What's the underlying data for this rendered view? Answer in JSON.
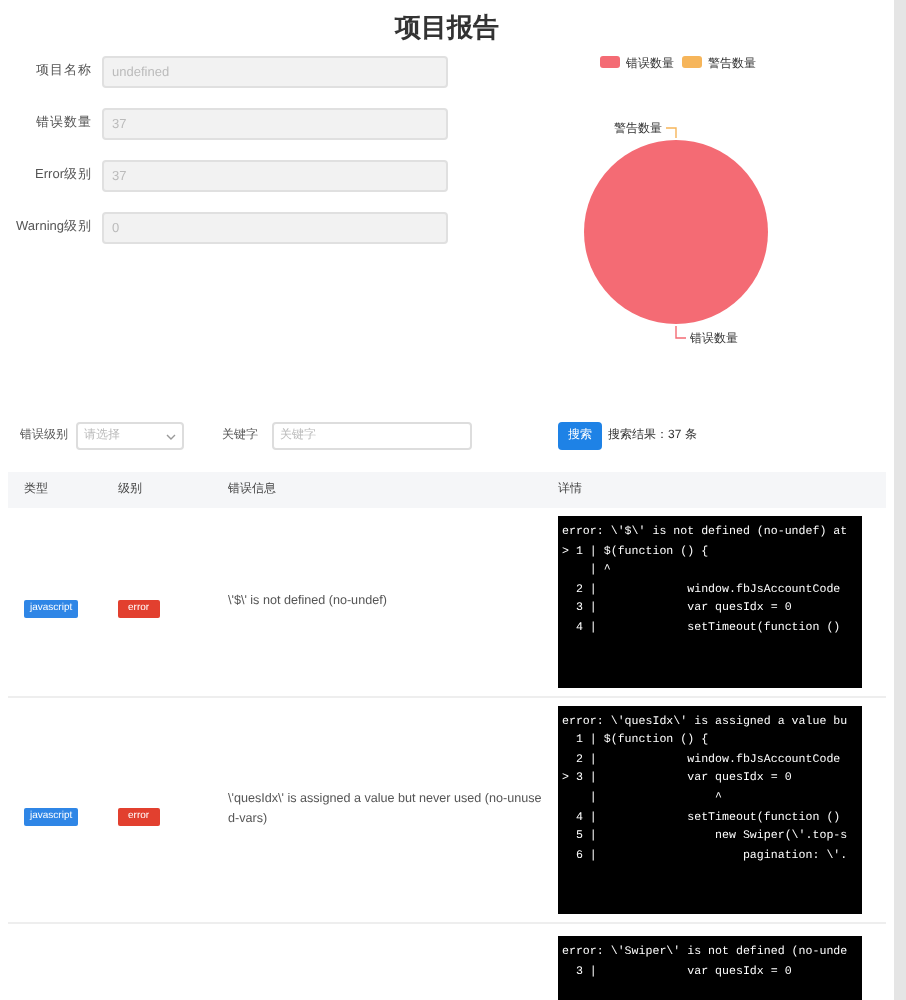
{
  "title": "项目报告",
  "form": [
    {
      "label": "项目名称",
      "value": "undefined"
    },
    {
      "label": "错误数量",
      "value": "37"
    },
    {
      "label": "Error级别",
      "value": "37"
    },
    {
      "label": "Warning级别",
      "value": "0"
    }
  ],
  "chart": {
    "chart_data": {
      "type": "pie",
      "categories": [
        "错误数量",
        "警告数量"
      ],
      "values": [
        100,
        0
      ],
      "colors": [
        "#f46b74",
        "#f6b55a"
      ]
    }
  },
  "filters": {
    "level_label": "错误级别",
    "level_placeholder": "请选择",
    "keyword_label": "关键字",
    "keyword_placeholder": "关键字",
    "search_button": "搜索",
    "result_text": "搜索结果：37 条"
  },
  "table": {
    "columns": [
      "类型",
      "级别",
      "错误信息",
      "详情"
    ],
    "rows": [
      {
        "type": "javascript",
        "level": "error",
        "message": "\\'$\\' is not defined (no-undef)",
        "detail": [
          "error: \\'$\\' is not defined (no-undef) at",
          "> 1 | $(function () {",
          "    | ^",
          "  2 |             window.fbJsAccountCode",
          "  3 |             var quesIdx = 0",
          "  4 |             setTimeout(function ()"
        ]
      },
      {
        "type": "javascript",
        "level": "error",
        "message": "\\'quesIdx\\' is assigned a value but never used (no-unused-vars)",
        "detail": [
          "error: \\'quesIdx\\' is assigned a value bu",
          "  1 | $(function () {",
          "  2 |             window.fbJsAccountCode",
          "> 3 |             var quesIdx = 0",
          "    |                 ^",
          "  4 |             setTimeout(function ()",
          "  5 |                 new Swiper(\\'.top-s",
          "  6 |                     pagination: \\'."
        ]
      },
      {
        "detail": [
          "error: \\'Swiper\\' is not defined (no-unde",
          "  3 |             var quesIdx = 0"
        ]
      }
    ]
  }
}
